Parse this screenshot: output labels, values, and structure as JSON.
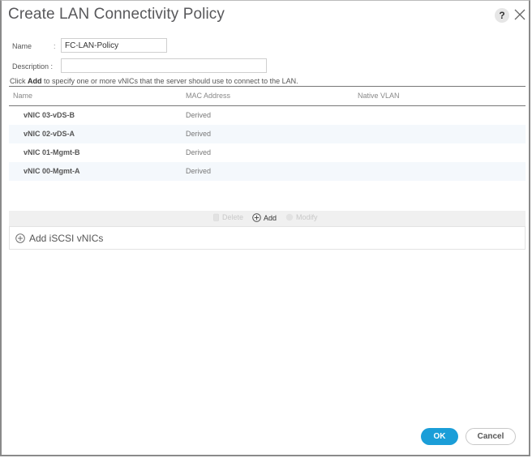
{
  "dialog": {
    "title": "Create LAN Connectivity Policy",
    "help_label": "?",
    "close_label": "close"
  },
  "form": {
    "name_label": "Name",
    "name_colon": ":",
    "name_value": "FC-LAN-Policy",
    "description_label": "Description :",
    "description_value": "",
    "description_placeholder": ""
  },
  "hint": {
    "prefix": "Click ",
    "bold": "Add",
    "suffix": " to specify one or more vNICs that the server should use to connect to the LAN."
  },
  "table": {
    "columns": [
      "Name",
      "MAC Address",
      "Native VLAN"
    ],
    "rows": [
      {
        "name": "vNIC 03-vDS-B",
        "mac": "Derived",
        "vlan": ""
      },
      {
        "name": "vNIC 02-vDS-A",
        "mac": "Derived",
        "vlan": ""
      },
      {
        "name": "vNIC 01-Mgmt-B",
        "mac": "Derived",
        "vlan": ""
      },
      {
        "name": "vNIC 00-Mgmt-A",
        "mac": "Derived",
        "vlan": ""
      }
    ]
  },
  "toolbar": {
    "delete_label": "Delete",
    "add_label": "Add",
    "modify_label": "Modify"
  },
  "iscsi": {
    "label": "Add iSCSI vNICs"
  },
  "footer": {
    "ok_label": "OK",
    "cancel_label": "Cancel"
  },
  "colors": {
    "primary": "#1b9ed8",
    "row_alt": "#f4f8fc"
  }
}
